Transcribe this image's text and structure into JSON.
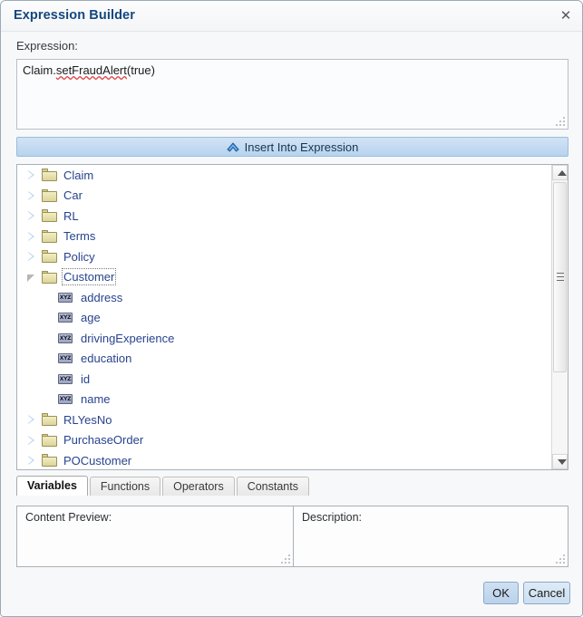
{
  "dialog": {
    "title": "Expression Builder",
    "close_icon": "close-icon"
  },
  "expression": {
    "label": "Expression:",
    "value": "Claim.setFraudAlert(true)",
    "misspelled_segment": "setFraudAlert",
    "prefix_segment": "Claim.",
    "suffix_segment": "(true)",
    "placeholder": ""
  },
  "insert_button": {
    "label": "Insert Into Expression",
    "icon": "chevron-up-icon"
  },
  "tree": {
    "nodes": [
      {
        "label": "Claim",
        "type": "folder",
        "expanded": false,
        "depth": 0,
        "focused": false
      },
      {
        "label": "Car",
        "type": "folder",
        "expanded": false,
        "depth": 0,
        "focused": false
      },
      {
        "label": "RL",
        "type": "folder",
        "expanded": false,
        "depth": 0,
        "focused": false
      },
      {
        "label": "Terms",
        "type": "folder",
        "expanded": false,
        "depth": 0,
        "focused": false
      },
      {
        "label": "Policy",
        "type": "folder",
        "expanded": false,
        "depth": 0,
        "focused": false
      },
      {
        "label": "Customer",
        "type": "folder",
        "expanded": true,
        "depth": 0,
        "focused": true
      },
      {
        "label": "address",
        "type": "variable",
        "expanded": false,
        "depth": 1,
        "focused": false
      },
      {
        "label": "age",
        "type": "variable",
        "expanded": false,
        "depth": 1,
        "focused": false
      },
      {
        "label": "drivingExperience",
        "type": "variable",
        "expanded": false,
        "depth": 1,
        "focused": false
      },
      {
        "label": "education",
        "type": "variable",
        "expanded": false,
        "depth": 1,
        "focused": false
      },
      {
        "label": "id",
        "type": "variable",
        "expanded": false,
        "depth": 1,
        "focused": false
      },
      {
        "label": "name",
        "type": "variable",
        "expanded": false,
        "depth": 1,
        "focused": false
      },
      {
        "label": "RLYesNo",
        "type": "folder",
        "expanded": false,
        "depth": 0,
        "focused": false
      },
      {
        "label": "PurchaseOrder",
        "type": "folder",
        "expanded": false,
        "depth": 0,
        "focused": false
      },
      {
        "label": "POCustomer",
        "type": "folder",
        "expanded": false,
        "depth": 0,
        "focused": false
      }
    ],
    "variable_icon_text": "XYZ",
    "scrollbar": {
      "up_icon": "scroll-up-arrow-icon",
      "down_icon": "scroll-down-arrow-icon"
    }
  },
  "tabs": [
    {
      "label": "Variables",
      "active": true
    },
    {
      "label": "Functions",
      "active": false
    },
    {
      "label": "Operators",
      "active": false
    },
    {
      "label": "Constants",
      "active": false
    }
  ],
  "panels": {
    "content_preview_label": "Content Preview:",
    "content_preview_value": "",
    "description_label": "Description:",
    "description_value": ""
  },
  "footer": {
    "ok_label": "OK",
    "cancel_label": "Cancel"
  },
  "colors": {
    "title_text": "#14477d",
    "tree_label": "#27438e",
    "accent_button": "#b7d3ee",
    "folder": "#ddd49a",
    "spellcheck_underline": "#e04040"
  }
}
